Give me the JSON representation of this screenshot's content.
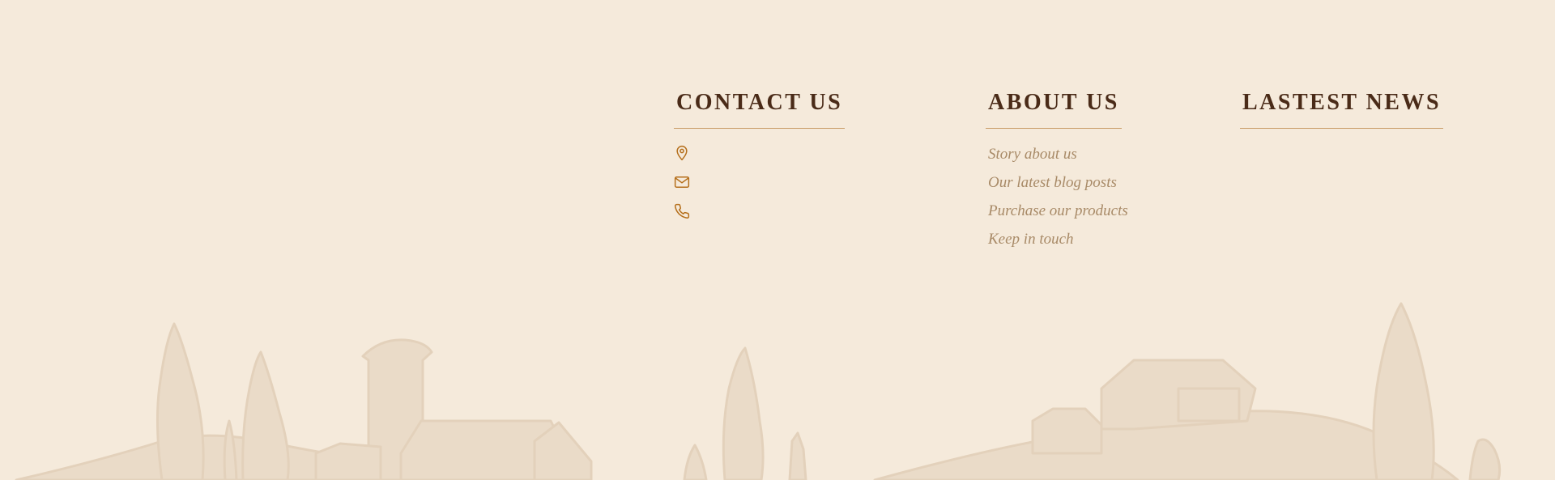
{
  "footer": {
    "contact": {
      "title": "CONTACT US",
      "items": [
        {
          "icon": "map-pin-icon",
          "text": ""
        },
        {
          "icon": "mail-icon",
          "text": ""
        },
        {
          "icon": "phone-icon",
          "text": ""
        }
      ]
    },
    "about": {
      "title": "ABOUT US",
      "links": [
        "Story about us",
        "Our latest blog posts",
        "Purchase our products",
        "Keep in touch"
      ]
    },
    "news": {
      "title": "LASTEST NEWS"
    }
  },
  "colors": {
    "background": "#f5eadb",
    "heading": "#4a2b18",
    "accent": "#c89a64",
    "icon": "#b56f1b",
    "link": "#a88a67",
    "illustration": "#e8d8c4"
  }
}
